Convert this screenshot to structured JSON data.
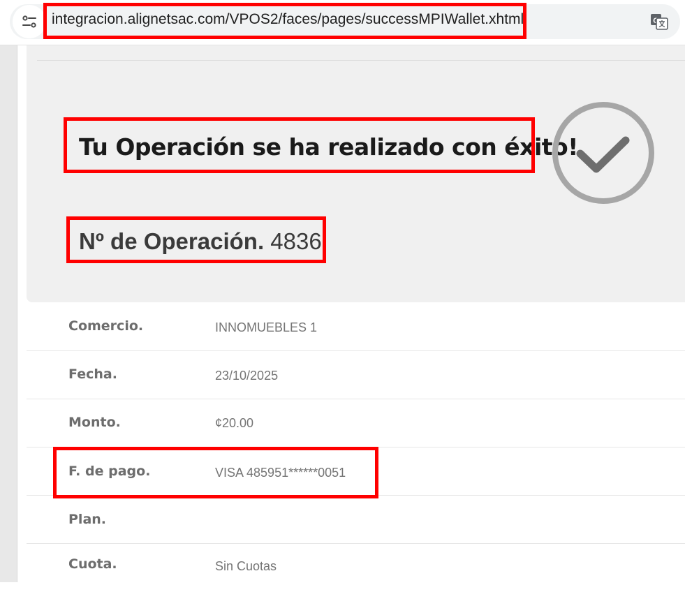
{
  "browser": {
    "url": "integracion.alignetsac.com/VPOS2/faces/pages/successMPIWallet.xhtml",
    "site_info_icon": "tune-icon",
    "translate_icon": "google-translate-icon"
  },
  "result": {
    "title": "Tu Operación se ha realizado con éxito!",
    "operation_label": "Nº de Operación.",
    "operation_number": "4836",
    "status_icon": "check-circle-icon"
  },
  "details": {
    "commerce": {
      "label": "Comercio.",
      "value": "INNOMUEBLES 1"
    },
    "date": {
      "label": "Fecha.",
      "value": "23/10/2025"
    },
    "amount": {
      "label": "Monto.",
      "value": "¢20.00"
    },
    "payment_method": {
      "label": "F. de pago.",
      "value": "VISA 485951******0051"
    },
    "plan": {
      "label": "Plan.",
      "value": ""
    },
    "installments": {
      "label": "Cuota.",
      "value": "Sin Cuotas"
    }
  },
  "colors": {
    "highlight": "#ff0000",
    "panel": "#f0f0f0",
    "check": "#a6a6a6"
  }
}
